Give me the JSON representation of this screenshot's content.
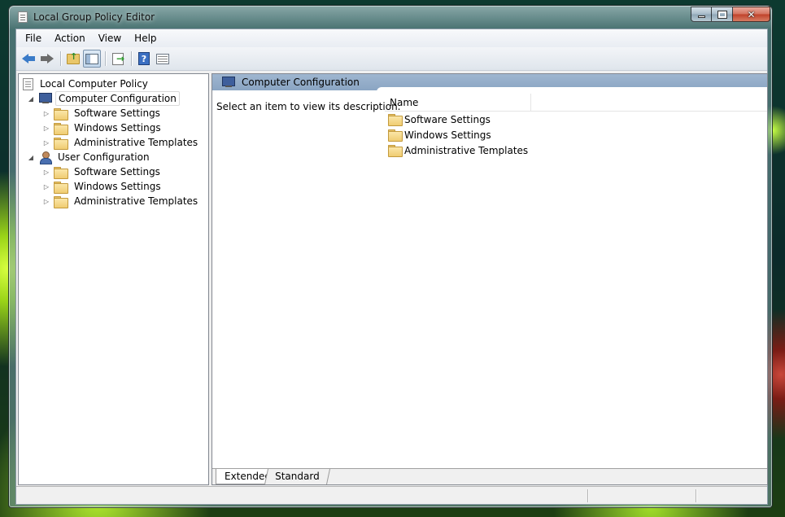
{
  "window": {
    "title": "Local Group Policy Editor",
    "icon": "policy-document-icon"
  },
  "menubar": {
    "items": [
      "File",
      "Action",
      "View",
      "Help"
    ]
  },
  "toolbar": {
    "buttons": [
      "back-icon",
      "forward-icon",
      "up-folder-icon",
      "show-hide-tree-icon",
      "export-list-icon",
      "help-icon",
      "view-icon"
    ]
  },
  "tree": {
    "root": "Local Computer Policy",
    "computer": {
      "label": "Computer Configuration",
      "children": [
        "Software Settings",
        "Windows Settings",
        "Administrative Templates"
      ]
    },
    "user": {
      "label": "User Configuration",
      "children": [
        "Software Settings",
        "Windows Settings",
        "Administrative Templates"
      ]
    }
  },
  "details": {
    "header_title": "Computer Configuration",
    "description": "Select an item to view its description.",
    "column_name": "Name",
    "items": [
      "Software Settings",
      "Windows Settings",
      "Administrative Templates"
    ],
    "tabs": [
      "Extended",
      "Standard"
    ]
  },
  "colors": {
    "header_band": "#8aa5c3",
    "folder": "#f0cc72",
    "accent_blue": "#3a7bc8"
  }
}
